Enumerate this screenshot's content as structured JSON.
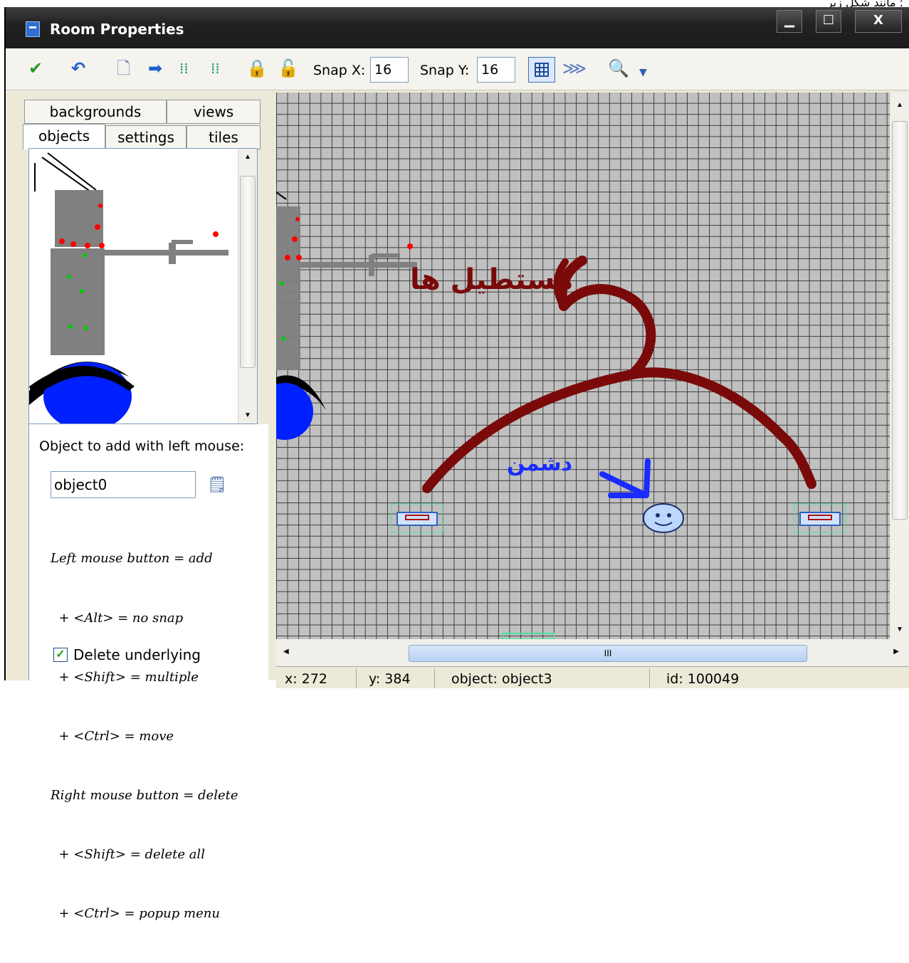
{
  "page_caption": "مانند شکل زیر :",
  "window": {
    "title": "Room Properties",
    "controls": [
      "▁",
      "☐",
      "X"
    ]
  },
  "toolbar": {
    "snap_x_label": "Snap X:",
    "snap_x_value": "16",
    "snap_y_label": "Snap Y:",
    "snap_y_value": "16"
  },
  "tabs": {
    "row1": [
      "backgrounds",
      "views"
    ],
    "row2": [
      "objects",
      "settings",
      "tiles"
    ],
    "active": "objects"
  },
  "object_panel": {
    "add_label": "Object to add with left mouse:",
    "object_name": "object0",
    "help_lines": [
      "Left mouse button = add",
      "  + <Alt> = no snap",
      "  + <Shift> = multiple",
      "  + <Ctrl> = move",
      "Right mouse button = delete",
      "  + <Shift> = delete all",
      "  + <Ctrl> = popup menu"
    ],
    "delete_underlying_label": "Delete underlying",
    "delete_underlying_checked": true
  },
  "room": {
    "annotation_rectangles": "مستطیل ها",
    "annotation_enemy": "دشمن",
    "hscroll_grip": "III"
  },
  "status_bar": {
    "x": "x: 272",
    "y": "y: 384",
    "object": "object: object3",
    "id": "id: 100049"
  },
  "colors": {
    "annotation_dark_red": "#7a0a0a",
    "annotation_blue": "#1a2bff",
    "grid_bg": "#c0c0c0"
  }
}
